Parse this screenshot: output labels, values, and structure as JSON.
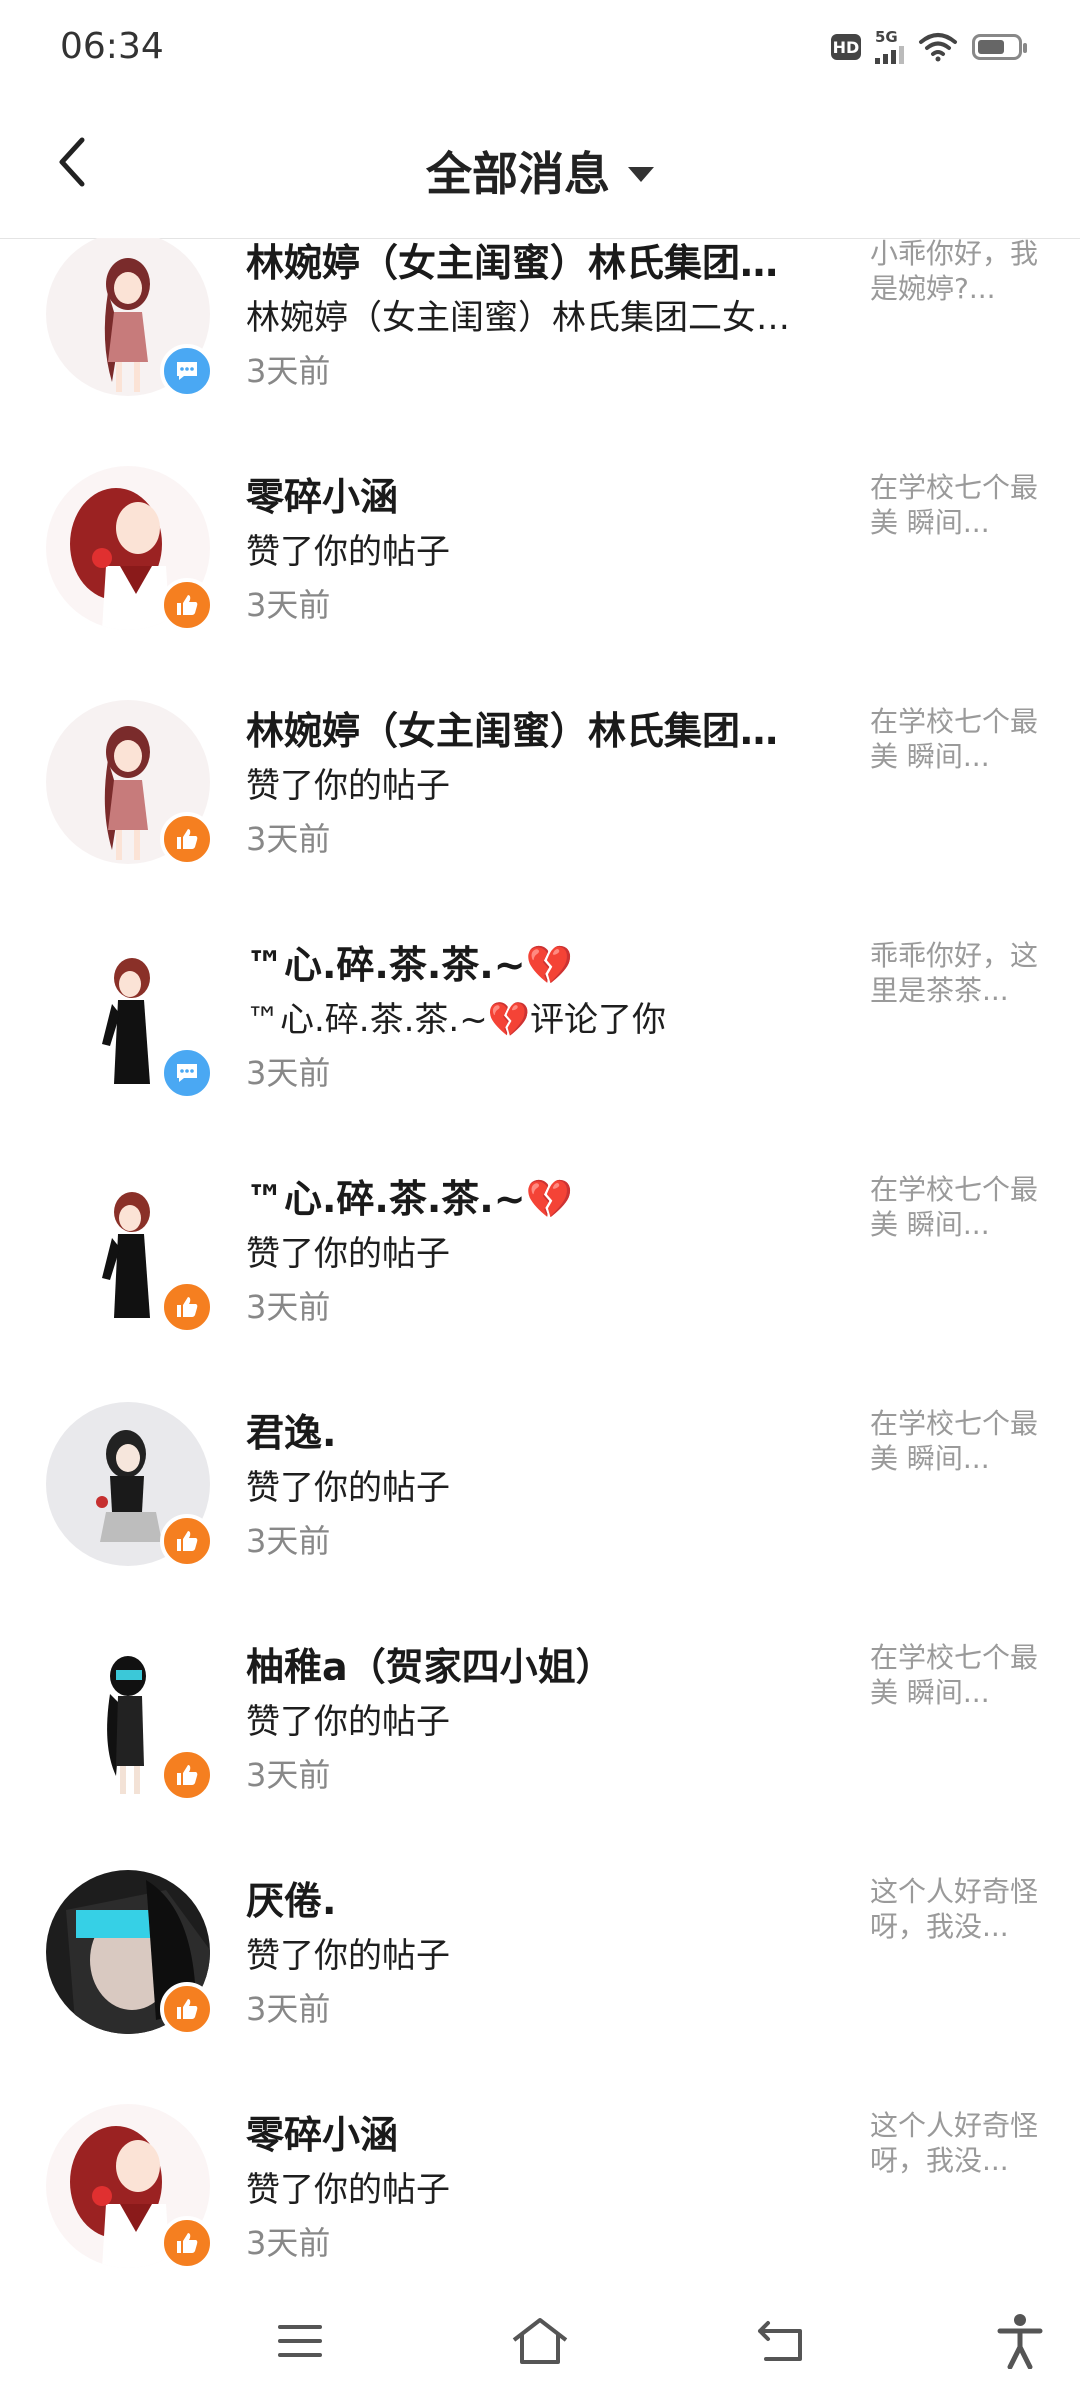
{
  "status_bar": {
    "time": "06:34",
    "hd": "HD",
    "network": "5G"
  },
  "header": {
    "title": "全部消息"
  },
  "messages": [
    {
      "name": "林婉婷（女主闺蜜）林氏集团…",
      "action": "林婉婷（女主闺蜜）林氏集团二女…",
      "time": "3天前",
      "preview": "小乖你好，我是婉婷?...",
      "type": "comment"
    },
    {
      "name": "零碎小涵",
      "action": "赞了你的帖子",
      "time": "3天前",
      "preview": "在学校七个最美 瞬间...",
      "type": "like"
    },
    {
      "name": "林婉婷（女主闺蜜）林氏集团…",
      "action": "赞了你的帖子",
      "time": "3天前",
      "preview": "在学校七个最美 瞬间...",
      "type": "like"
    },
    {
      "name": "™心.碎.茶.茶.~💔",
      "action": "™心.碎.茶.茶.~💔评论了你",
      "time": "3天前",
      "preview": "乖乖你好，这里是茶茶...",
      "type": "comment"
    },
    {
      "name": "™心.碎.茶.茶.~💔",
      "action": "赞了你的帖子",
      "time": "3天前",
      "preview": "在学校七个最美 瞬间...",
      "type": "like"
    },
    {
      "name": "君逸.",
      "action": "赞了你的帖子",
      "time": "3天前",
      "preview": "在学校七个最美 瞬间...",
      "type": "like"
    },
    {
      "name": "柚稚a（贺家四小姐）",
      "action": "赞了你的帖子",
      "time": "3天前",
      "preview": "在学校七个最美 瞬间...",
      "type": "like"
    },
    {
      "name": "厌倦.",
      "action": "赞了你的帖子",
      "time": "3天前",
      "preview": "这个人好奇怪呀，我没...",
      "type": "like"
    },
    {
      "name": "零碎小涵",
      "action": "赞了你的帖子",
      "time": "3天前",
      "preview": "这个人好奇怪呀，我没...",
      "type": "like"
    }
  ],
  "colors": {
    "like_badge": "#f57f20",
    "comment_badge": "#4aa8f3"
  },
  "nav_icons": [
    "menu-icon",
    "home-icon",
    "back-icon",
    "accessibility-icon"
  ]
}
